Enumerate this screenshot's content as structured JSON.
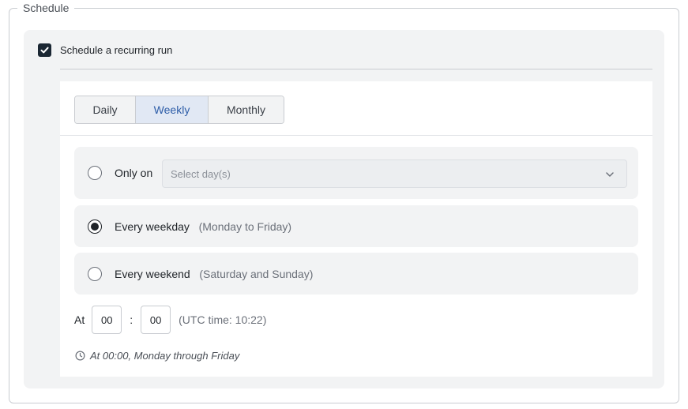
{
  "fieldset": {
    "legend": "Schedule"
  },
  "recurring": {
    "label": "Schedule a recurring run",
    "checked": true
  },
  "tabs": [
    {
      "label": "Daily",
      "active": false
    },
    {
      "label": "Weekly",
      "active": true
    },
    {
      "label": "Monthly",
      "active": false
    }
  ],
  "options": {
    "only_on": {
      "label": "Only on",
      "placeholder": "Select day(s)",
      "selected": false
    },
    "weekday": {
      "label": "Every weekday",
      "hint": "(Monday to Friday)",
      "selected": true
    },
    "weekend": {
      "label": "Every weekend",
      "hint": "(Saturday and Sunday)",
      "selected": false
    }
  },
  "time": {
    "label": "At",
    "hour": "00",
    "separator": ":",
    "minute": "00",
    "utc_note": "(UTC time: 10:22)"
  },
  "summary": {
    "text": "At 00:00, Monday through Friday",
    "icon": "clock-icon"
  },
  "colors": {
    "accent_tab_bg": "#e1e8f4",
    "accent_tab_text": "#2d5da8",
    "checkbox": "#1b2733"
  }
}
